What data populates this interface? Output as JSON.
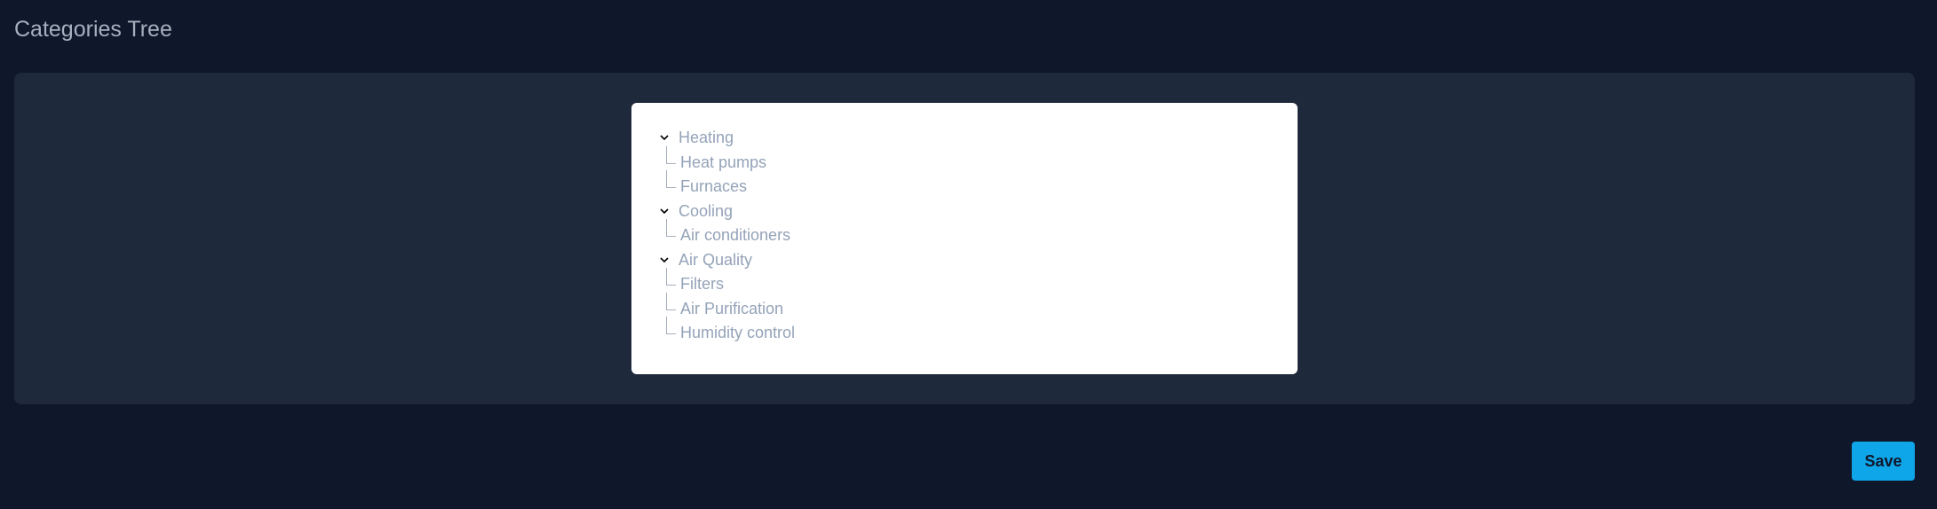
{
  "page": {
    "title": "Categories Tree"
  },
  "tree": {
    "groups": [
      {
        "label": "Heating",
        "expanded": true,
        "children": [
          "Heat pumps",
          "Furnaces"
        ]
      },
      {
        "label": "Cooling",
        "expanded": true,
        "children": [
          "Air conditioners"
        ]
      },
      {
        "label": "Air Quality",
        "expanded": true,
        "children": [
          "Filters",
          "Air Purification",
          "Humidity control"
        ]
      }
    ]
  },
  "actions": {
    "save_label": "Save"
  },
  "colors": {
    "background": "#0f172a",
    "panel": "#1e293b",
    "card": "#ffffff",
    "text_muted": "#94a3b8",
    "accent": "#0ea5e9"
  },
  "icons": {
    "toggle": "chevron-down-icon"
  }
}
